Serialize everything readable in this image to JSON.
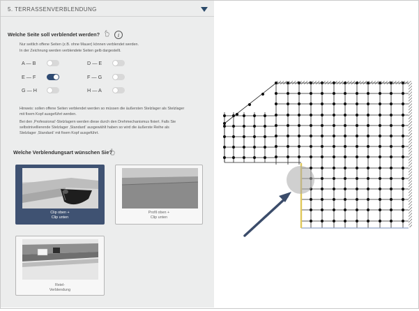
{
  "section_title": "5. TERRASSENVERBLENDUNG",
  "side_question": "Welche Seite soll verblendet werden?",
  "side_notes": [
    "Nur seitlich offene Seiten (z.B. ohne Mauer) können verblendet werden.",
    "In der Zeichnung werden verblendete Seiten gelb dargestellt."
  ],
  "sides": [
    {
      "label": "A — B",
      "on": false
    },
    {
      "label": "D — E",
      "on": false
    },
    {
      "label": "E — F",
      "on": true
    },
    {
      "label": "F — G",
      "on": false
    },
    {
      "label": "G — H",
      "on": false
    },
    {
      "label": "H — A",
      "on": false
    }
  ],
  "hint_lines": [
    "Hinweis: sollen offene Seiten verblendet werden so müssen die äußersten Stelzlager als Stelzlager",
    "mit fixem Kopf ausgeführt werden.",
    "Bei den ‚Professional‘-Stelzlagern werden diese durch den Drehmechanismus fixiert. Falls Sie",
    "selbstnivellierende Stelzlager ‚Standard‘ ausgewählt haben so wird die äußerste Reihe als",
    "Stelzlager ‚Standard‘ mit fixem Kopf ausgeführt."
  ],
  "type_question": "Welche Verblendungsart wünschen Sie?",
  "options": [
    {
      "caption": [
        "Clip oben +",
        "Clip unten"
      ],
      "selected": true
    },
    {
      "caption": [
        "Profil oben +",
        "Clip unten"
      ],
      "selected": false
    },
    {
      "caption": [
        "Reiel-",
        "Verblendung"
      ],
      "selected": false
    }
  ],
  "icons": {
    "collapse": "triangle-down-icon",
    "help": "hand-pointer-icon",
    "info": "info-icon"
  },
  "colors": {
    "accent": "#2e4a72",
    "selected_card": "#3f5272",
    "highlight": "#e8d36a",
    "panel_bg": "#eceded"
  }
}
